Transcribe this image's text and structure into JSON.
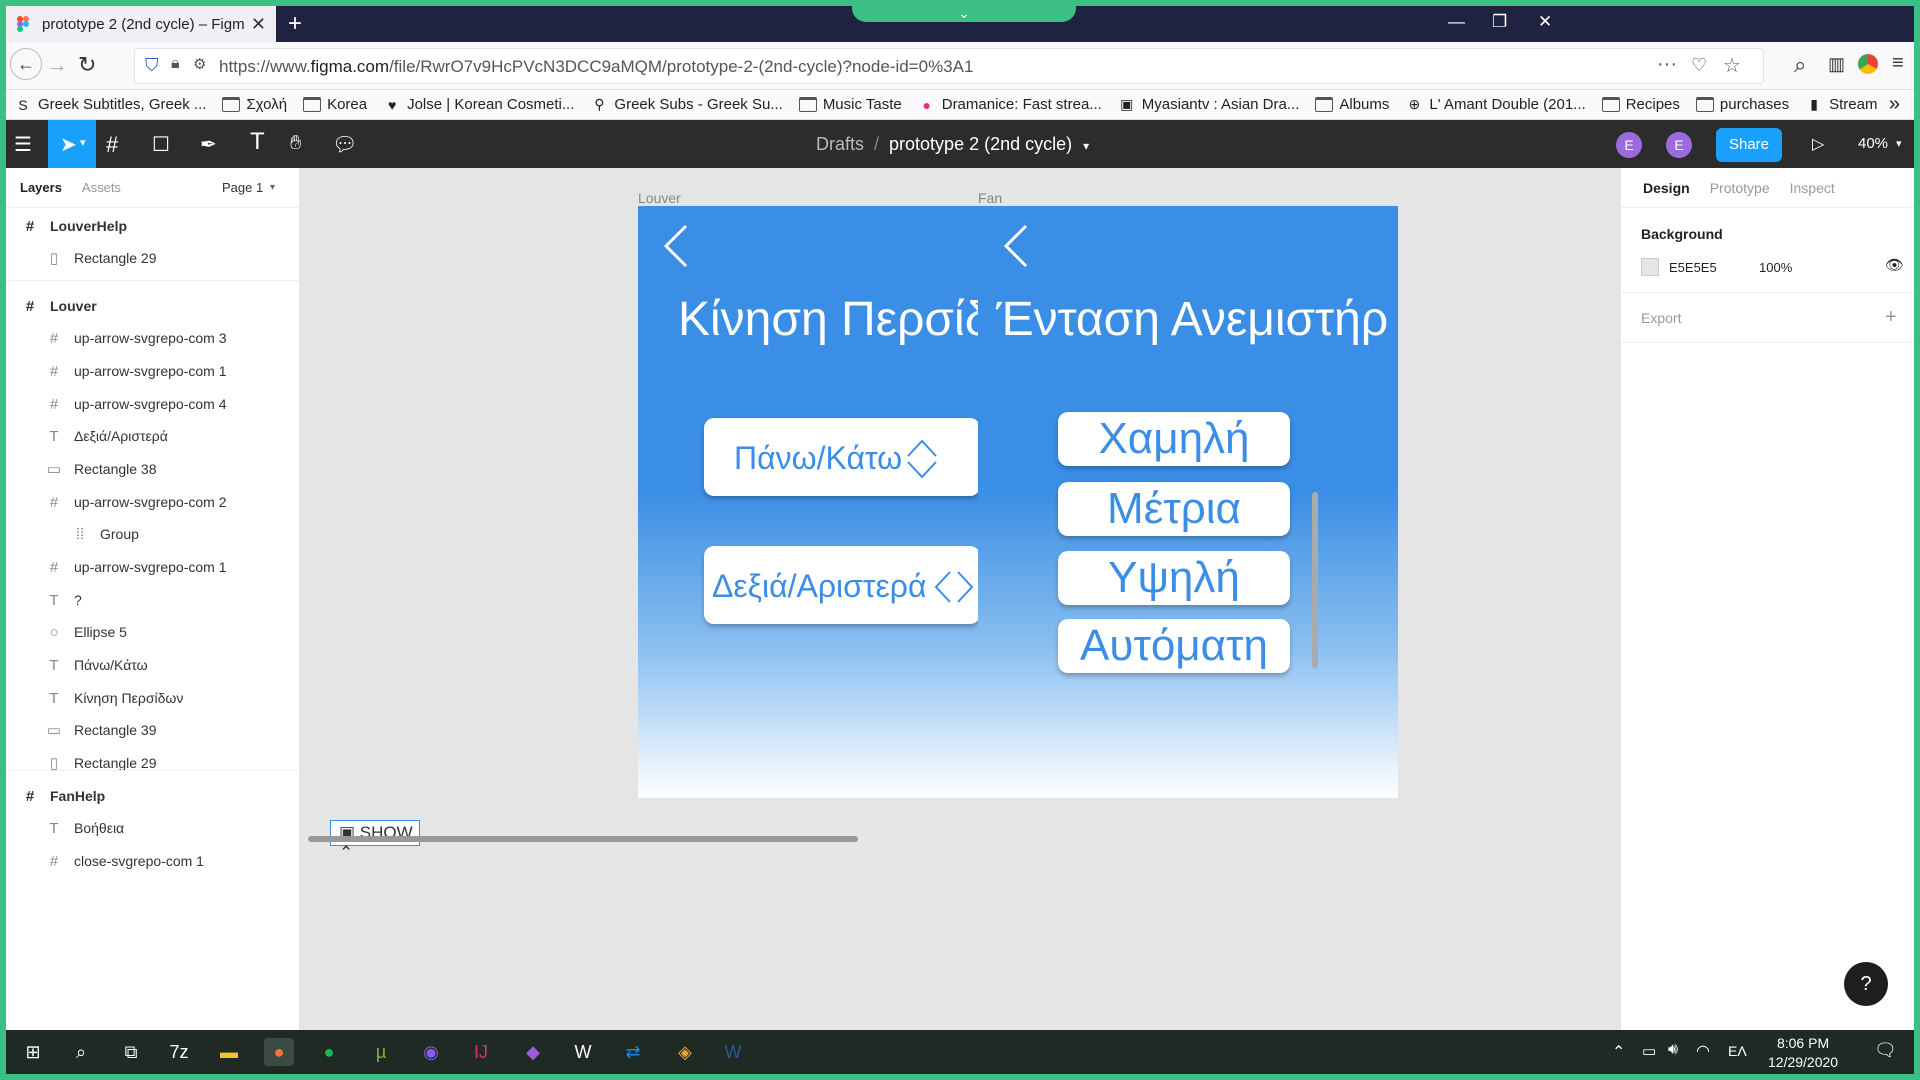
{
  "browser": {
    "tab_title": "prototype 2 (2nd cycle) – Figm",
    "url_prefix": "https://www.",
    "url_domain": "figma.com",
    "url_rest": "/file/RwrO7v9HcPVcN3DCC9aMQM/prototype-2-(2nd-cycle)?node-id=0%3A1",
    "new_tab": "+",
    "dropdown_glyph": "⌄"
  },
  "bookmarks": [
    {
      "label": "Greek Subtitles, Greek ...",
      "icon": "sf-icon"
    },
    {
      "label": "Σχολή",
      "icon": "folder-icon"
    },
    {
      "label": "Korea",
      "icon": "folder-icon"
    },
    {
      "label": "Jolse | Korean Cosmeti...",
      "icon": "heart-icon"
    },
    {
      "label": "Greek Subs - Greek Su...",
      "icon": "magnifier-icon"
    },
    {
      "label": "Music Taste",
      "icon": "folder-icon"
    },
    {
      "label": "Dramanice: Fast strea...",
      "icon": "dramanice-icon"
    },
    {
      "label": "Myasiantv : Asian Dra...",
      "icon": "tv-icon"
    },
    {
      "label": "Albums",
      "icon": "folder-icon"
    },
    {
      "label": "L' Amant Double (201...",
      "icon": "globe-icon"
    },
    {
      "label": "Recipes",
      "icon": "folder-icon"
    },
    {
      "label": "purchases",
      "icon": "folder-icon"
    },
    {
      "label": "Stream",
      "icon": "stream-icon"
    }
  ],
  "figma_toolbar": {
    "breadcrumb_parent": "Drafts",
    "breadcrumb_sep": "/",
    "file_name": "prototype 2 (2nd cycle)",
    "avatar1": "E",
    "avatar2": "E",
    "share_label": "Share",
    "zoom": "40%"
  },
  "left_panel": {
    "tab_layers": "Layers",
    "tab_assets": "Assets",
    "page": "Page 1",
    "layers": [
      {
        "name": "LouverHelp",
        "icon": "#",
        "frame": true
      },
      {
        "name": "Rectangle 29",
        "icon": "▯"
      },
      {
        "name": "Louver",
        "icon": "#",
        "frame": true
      },
      {
        "name": "up-arrow-svgrepo-com 3",
        "icon": "#"
      },
      {
        "name": "up-arrow-svgrepo-com 1",
        "icon": "#"
      },
      {
        "name": "up-arrow-svgrepo-com 4",
        "icon": "#"
      },
      {
        "name": "Δεξιά/Αριστερά",
        "icon": "T"
      },
      {
        "name": "Rectangle 38",
        "icon": "▭"
      },
      {
        "name": "up-arrow-svgrepo-com 2",
        "icon": "#"
      },
      {
        "name": "Group",
        "icon": "⁞⁞",
        "indent": true
      },
      {
        "name": "up-arrow-svgrepo-com 1",
        "icon": "#"
      },
      {
        "name": "?",
        "icon": "T"
      },
      {
        "name": "Ellipse 5",
        "icon": "○"
      },
      {
        "name": "Πάνω/Κάτω",
        "icon": "T"
      },
      {
        "name": "Κίνηση Περσίδων",
        "icon": "T"
      },
      {
        "name": "Rectangle 39",
        "icon": "▭"
      },
      {
        "name": "Rectangle 29",
        "icon": "▯"
      },
      {
        "name": "FanHelp",
        "icon": "#",
        "frame": true
      },
      {
        "name": "Βοήθεια",
        "icon": "T"
      },
      {
        "name": "close-svgrepo-com 1",
        "icon": "#"
      }
    ]
  },
  "canvas": {
    "louver": {
      "label": "Louver",
      "title": "Κίνηση Περσίδων",
      "help": "?",
      "btn_updown": "Πάνω/Κάτω",
      "btn_leftright": "Δεξιά/Αριστερά"
    },
    "fan": {
      "label": "Fan",
      "title": "Ένταση Ανεμιστήρ",
      "options": [
        "Χαμηλή",
        "Μέτρια",
        "Υψηλή",
        "Αυτόματη"
      ]
    },
    "show_label": "SHOW"
  },
  "right_panel": {
    "tab_design": "Design",
    "tab_prototype": "Prototype",
    "tab_inspect": "Inspect",
    "background_label": "Background",
    "bg_color_hex": "E5E5E5",
    "bg_opacity": "100%",
    "export_label": "Export",
    "help": "?"
  },
  "taskbar": {
    "time": "8:06 PM",
    "date": "12/29/2020",
    "lang": "ΕΛ",
    "apps": [
      "start-icon",
      "search-icon",
      "taskview-icon",
      "7zip-icon",
      "file-explorer-icon",
      "firefox-icon",
      "spotify-icon",
      "utorrent-icon",
      "audacity-icon",
      "intellij-icon",
      "visual-studio-icon",
      "vpn-icon",
      "teamviewer-icon",
      "git-icon",
      "word-icon"
    ]
  },
  "colors": {
    "accent": "#18a0fb",
    "phone_blue": "#3a8ee6",
    "frame_border": "#3bbf84"
  }
}
